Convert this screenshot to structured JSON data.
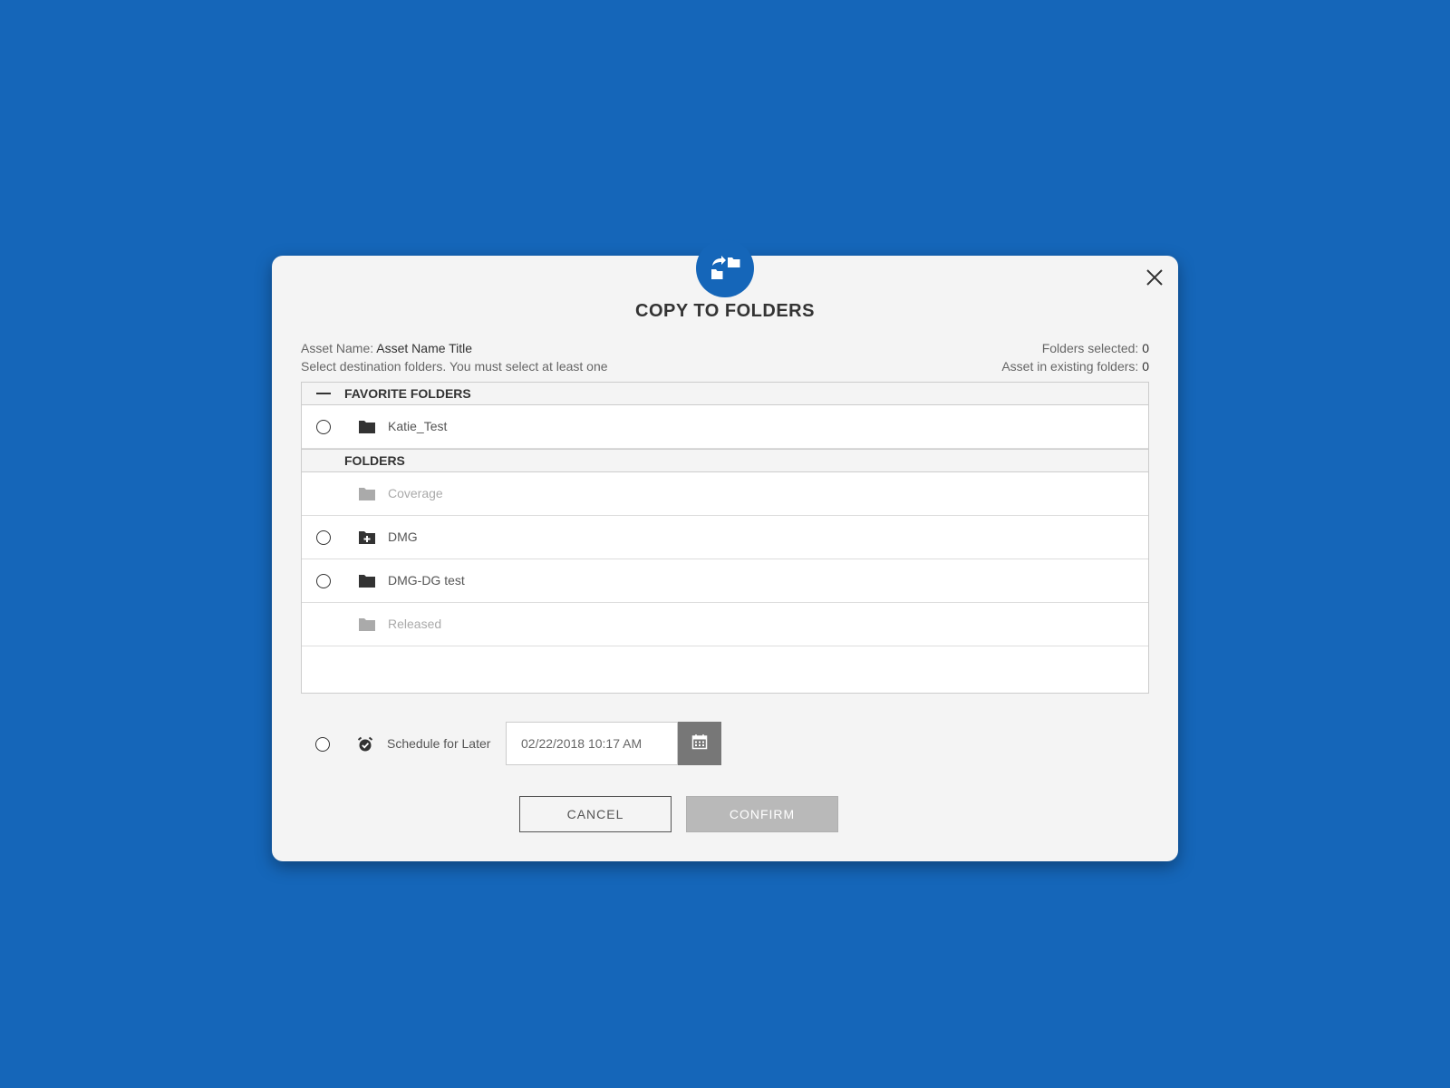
{
  "modal": {
    "title": "COPY TO FOLDERS",
    "asset_name_label": "Asset Name:",
    "asset_name_value": "Asset Name Title",
    "instruction": "Select destination folders. You must select at least one",
    "folders_selected_label": "Folders selected:",
    "folders_selected_value": "0",
    "existing_label": "Asset in existing folders:",
    "existing_value": "0"
  },
  "favorites": {
    "header": "FAVORITE FOLDERS",
    "items": [
      {
        "label": "Katie_Test",
        "icon": "folder-icon",
        "selectable": true
      }
    ]
  },
  "folders": {
    "header": "FOLDERS",
    "items": [
      {
        "label": "Coverage",
        "icon": "folder-icon",
        "selectable": false
      },
      {
        "label": "DMG",
        "icon": "folder-plus-icon",
        "selectable": true
      },
      {
        "label": "DMG-DG test",
        "icon": "folder-icon",
        "selectable": true
      },
      {
        "label": "Released",
        "icon": "folder-icon",
        "selectable": false
      }
    ]
  },
  "schedule": {
    "label": "Schedule for Later",
    "datetime": "02/22/2018 10:17 AM"
  },
  "actions": {
    "cancel": "CANCEL",
    "confirm": "CONFIRM"
  },
  "colors": {
    "background": "#1566b9",
    "modal": "#f4f4f4",
    "confirm_disabled": "#b9b9b9",
    "calendar_button": "#777777"
  }
}
